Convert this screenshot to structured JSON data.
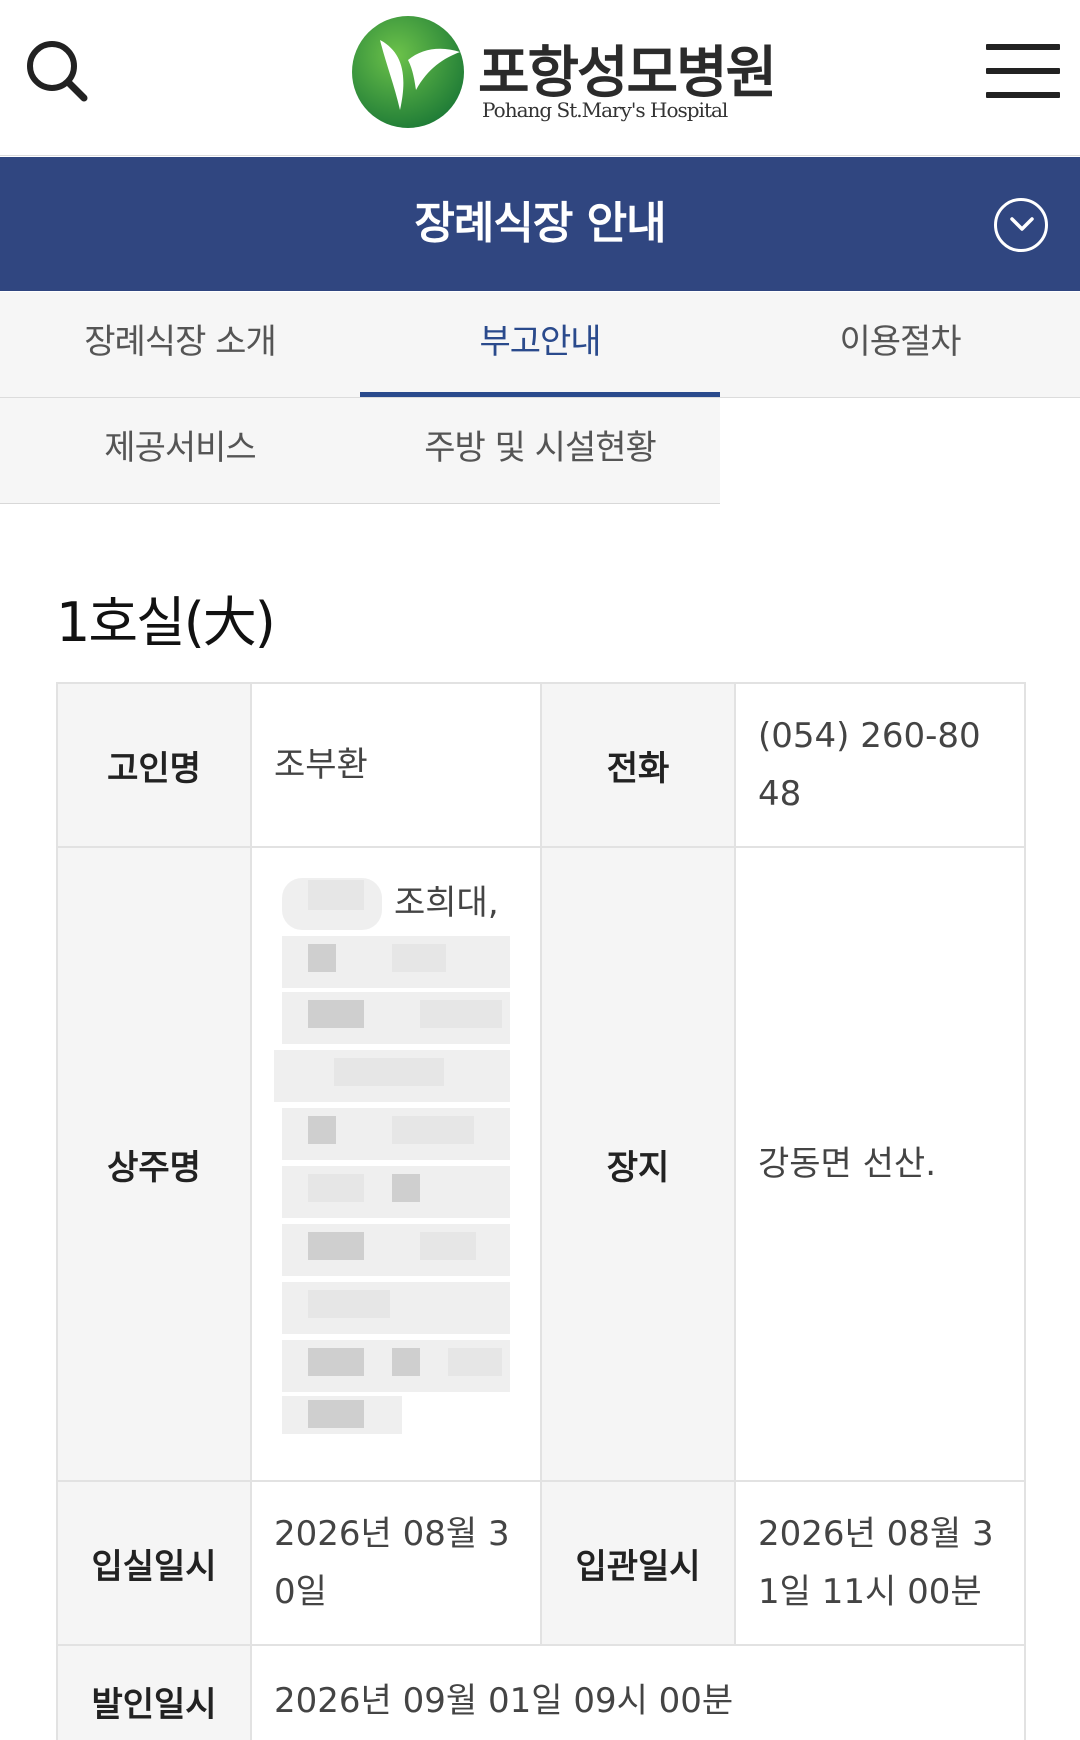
{
  "header": {
    "logo_ko": "포항성모병원",
    "logo_en": "Pohang St.Mary's Hospital",
    "search_icon": "search-icon",
    "menu_icon": "hamburger-menu-icon",
    "colors": {
      "brand_green": "#2e9b3e",
      "text": "#2b2b2b"
    }
  },
  "titlebar": {
    "title": "장례식장 안내",
    "toggle_icon": "chevron-down-circle-icon",
    "bg_color": "#304680"
  },
  "tabs": [
    {
      "label": "장례식장 소개",
      "active": false
    },
    {
      "label": "부고안내",
      "active": true
    },
    {
      "label": "이용절차",
      "active": false
    },
    {
      "label": "제공서비스",
      "active": false
    },
    {
      "label": "주방 및 시설현황",
      "active": false
    }
  ],
  "room": {
    "title": "1호실(大)",
    "rows": {
      "deceased_label": "고인명",
      "deceased_value": "조부환",
      "phone_label": "전화",
      "phone_value": "(054) 260-8048",
      "chief_mourner_label": "상주명",
      "chief_mourner_visible": "조희대,",
      "burial_label": "장지",
      "burial_value": "강동면 선산.",
      "checkin_label": "입실일시",
      "checkin_value": "2026년 08월 30일",
      "coffin_label": "입관일시",
      "coffin_value": "2026년 08월 31일 11시 00분",
      "departure_label": "발인일시",
      "departure_value": "2026년 09월 01일 09시 00분"
    }
  }
}
